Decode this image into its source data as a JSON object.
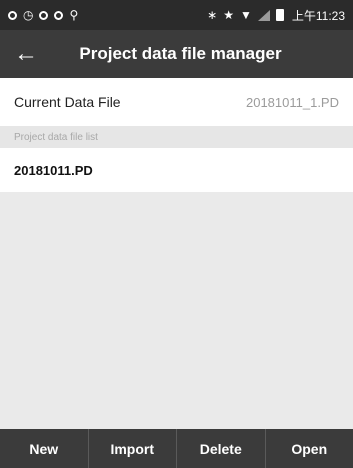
{
  "status_bar": {
    "time": "上午11:23",
    "left_icons": [
      "notification-ring-icon",
      "notification-clock-icon",
      "notification-ring-icon",
      "notification-ring-icon",
      "location-pin-icon"
    ],
    "right_icons": [
      "bluetooth-icon",
      "star-icon",
      "wifi-icon",
      "signal-icon",
      "battery-icon"
    ]
  },
  "header": {
    "title": "Project data file manager",
    "back_icon": "back-arrow-icon"
  },
  "current_file": {
    "label": "Current Data File",
    "value": "20181011_1.PD"
  },
  "file_list": {
    "header": "Project data file list",
    "items": [
      "20181011.PD"
    ]
  },
  "actions": {
    "new_label": "New",
    "import_label": "Import",
    "delete_label": "Delete",
    "open_label": "Open"
  },
  "colors": {
    "status_bar_bg": "#2b2b2b",
    "app_bar_bg": "#3b3b3b",
    "list_bg": "#eaeaea"
  }
}
